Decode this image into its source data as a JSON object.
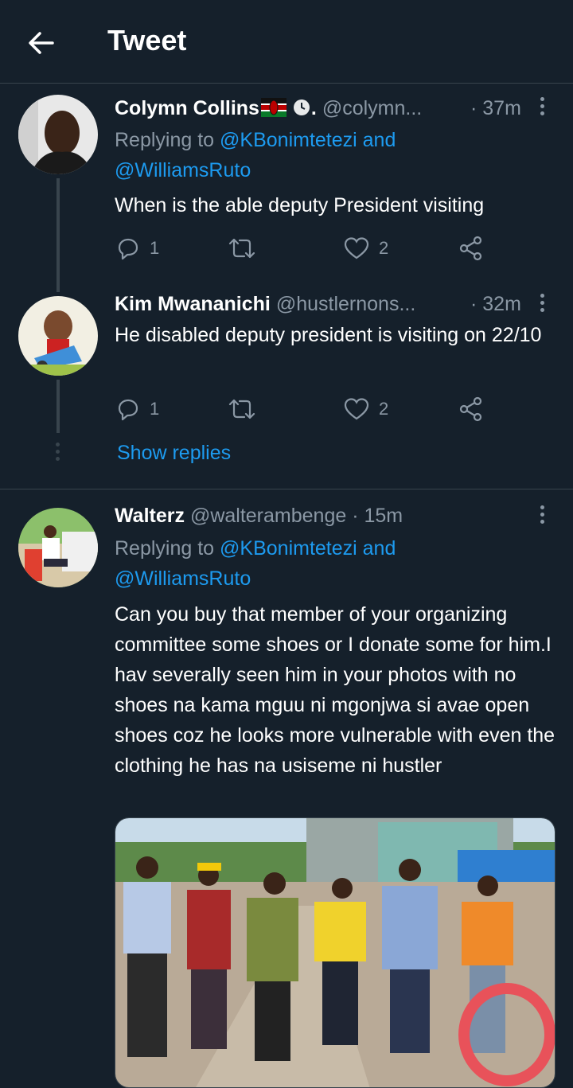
{
  "header": {
    "title": "Tweet"
  },
  "tweets": [
    {
      "name": "Colymn Collins",
      "badge_suffix": ".",
      "handle": "@colymn...",
      "time": "· 37m",
      "replying_prefix": "Replying to ",
      "replying_mentions": "@KBonimtetezi and",
      "replying_mentions2": "@WilliamsRuto",
      "text": "When is the able deputy President visiting",
      "reply_count": "1",
      "like_count": "2"
    },
    {
      "name": "Kim Mwananichi",
      "handle": "@hustlernons...",
      "time": "· 32m",
      "text": "He disabled deputy president is visiting on 22/10",
      "reply_count": "1",
      "like_count": "2"
    },
    {
      "name": "Walterz",
      "handle": "@walterambenge",
      "time": "· 15m",
      "replying_prefix": "Replying to ",
      "replying_mentions": "@KBonimtetezi and",
      "replying_mentions2": "@WilliamsRuto",
      "text": "Can you buy that member of your organizing committee some shoes or I donate some for him.I hav severally seen him in your photos with no shoes na kama mguu ni mgonjwa si avae open shoes coz he looks more vulnerable with even the clothing he has na usiseme ni hustler"
    }
  ],
  "show_replies": "Show replies",
  "colors": {
    "background": "#15202b",
    "accent": "#1d9bf0",
    "muted": "#8b98a5",
    "border": "#38444d"
  },
  "icons": [
    "back-arrow-icon",
    "flag-icon",
    "clock-icon",
    "more-icon",
    "reply-icon",
    "retweet-icon",
    "like-icon",
    "share-icon"
  ]
}
